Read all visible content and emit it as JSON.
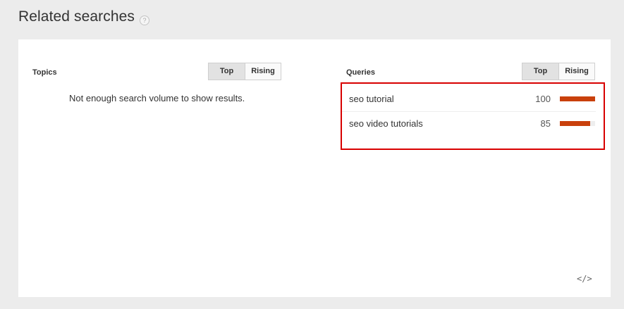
{
  "header": {
    "title": "Related searches",
    "help_icon": "?"
  },
  "topics": {
    "label": "Topics",
    "toggle": {
      "top": "Top",
      "rising": "Rising",
      "active": "top"
    },
    "empty_message": "Not enough search volume to show results."
  },
  "queries": {
    "label": "Queries",
    "toggle": {
      "top": "Top",
      "rising": "Rising",
      "active": "top"
    },
    "rows": [
      {
        "label": "seo tutorial",
        "value": 100
      },
      {
        "label": "seo video tutorials",
        "value": 85
      }
    ],
    "bar_color": "#c9400c",
    "highlight_color": "#d80000"
  },
  "footer": {
    "embed_icon": "</>"
  }
}
